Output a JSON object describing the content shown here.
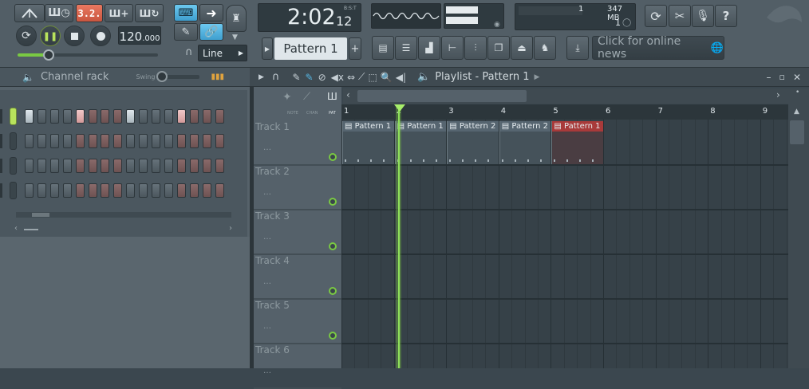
{
  "toolbar": {
    "time": "2:02",
    "time_sub": "12",
    "time_mode": "B:S:T",
    "tempo": "120",
    "tempo_dec": ".000",
    "song_pos_label": "3.2.",
    "cpu_value": "1",
    "memory": "347 MB",
    "poly": "1",
    "snap": "Line",
    "pattern": "Pattern 1",
    "news": "Click for online news"
  },
  "channel_rack": {
    "title": "Channel rack",
    "swing_label": "Swing"
  },
  "playlist": {
    "title": "Playlist - Pattern 1",
    "labels": {
      "note": "NOTE",
      "chan": "CHAN",
      "pat": "PAT"
    },
    "bars": [
      "1",
      "2",
      "3",
      "4",
      "5",
      "6",
      "7",
      "8",
      "9"
    ],
    "tracks": [
      "Track 1",
      "Track 2",
      "Track 3",
      "Track 4",
      "Track 5",
      "Track 6"
    ],
    "clips": [
      {
        "label": "Pattern 1",
        "color": "#566570"
      },
      {
        "label": "Pattern 1",
        "color": "#566570"
      },
      {
        "label": "Pattern 2",
        "color": "#566570"
      },
      {
        "label": "Pattern 2",
        "color": "#566570"
      },
      {
        "label": "Pattern 1",
        "color": "#a83a3a"
      }
    ]
  },
  "icons": {
    "toolbar": [
      "metronome-icon",
      "countdown-icon",
      "record-mode-icon",
      "step-edit-icon",
      "loop-record-icon",
      "typing-keyboard-icon",
      "arrow-icon",
      "wait-icon",
      "draw-icon",
      "link-icon",
      "undo-icon",
      "cut-icon",
      "mic-icon",
      "help-icon"
    ],
    "windows": [
      "playlist-icon",
      "channel-rack-icon",
      "piano-roll-icon",
      "mixer-icon",
      "browser-icon",
      "plugin-icon",
      "plugin-picker-icon",
      "download-icon",
      "globe-icon"
    ]
  },
  "colors": {
    "accent_green": "#7ac943",
    "accent_blue": "#55b4e0",
    "accent_red": "#c9553f"
  }
}
